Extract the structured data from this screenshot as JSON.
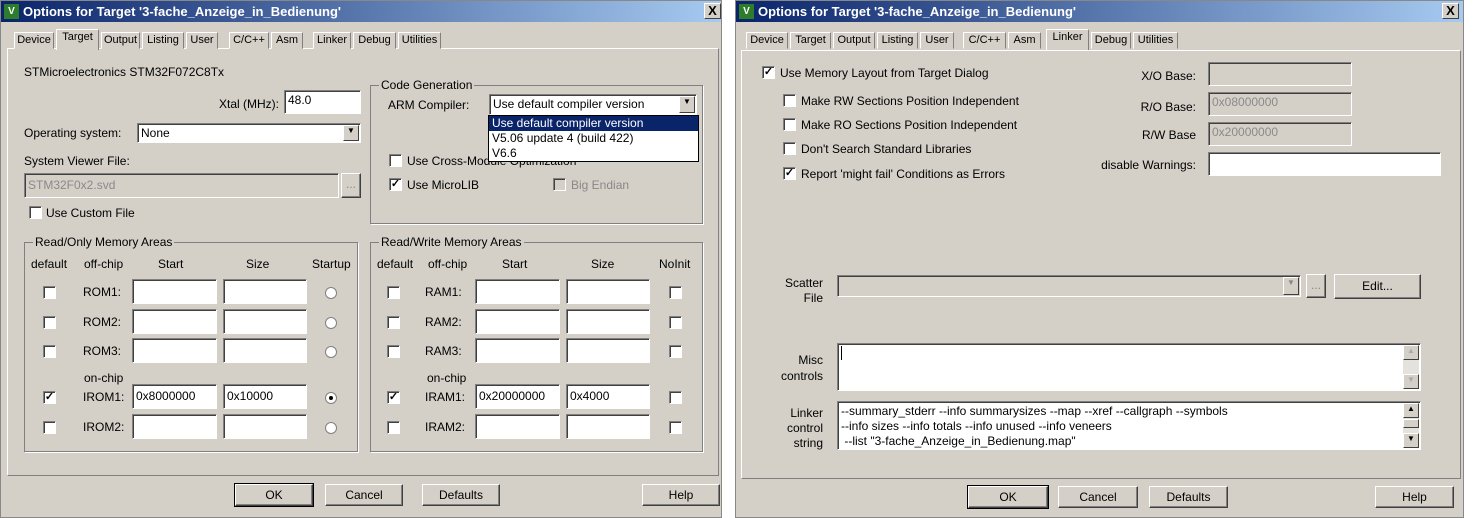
{
  "title": "Options for Target '3-fache_Anzeige_in_Bedienung'",
  "close_glyph": "X",
  "app_icon": "V",
  "tabs": [
    "Device",
    "Target",
    "Output",
    "Listing",
    "User",
    "C/C++",
    "Asm",
    "Linker",
    "Debug",
    "Utilities"
  ],
  "target": {
    "device": "STMicroelectronics STM32F072C8Tx",
    "xtal_label": "Xtal (MHz):",
    "xtal_value": "48.0",
    "os_label": "Operating system:",
    "os_value": "None",
    "svf_label": "System Viewer File:",
    "svf_value": "STM32F0x2.svd",
    "browse": "...",
    "custom_file": "Use Custom File",
    "codegen": {
      "title": "Code Generation",
      "compiler_label": "ARM Compiler:",
      "compiler_value": "Use default compiler version",
      "options": [
        "Use default compiler version",
        "V5.06 update 4 (build 422)",
        "V6.6"
      ],
      "cross_module": "Use Cross-Module Optimization",
      "microlib": "Use MicroLIB",
      "big_endian": "Big Endian"
    },
    "ro": {
      "title": "Read/Only Memory Areas",
      "headers": [
        "default",
        "off-chip",
        "Start",
        "Size",
        "Startup"
      ],
      "onchip": "on-chip",
      "rows": [
        {
          "name": "ROM1:",
          "checked": false,
          "start": "",
          "size": "",
          "radio": false
        },
        {
          "name": "ROM2:",
          "checked": false,
          "start": "",
          "size": "",
          "radio": false
        },
        {
          "name": "ROM3:",
          "checked": false,
          "start": "",
          "size": "",
          "radio": false
        },
        {
          "name": "IROM1:",
          "checked": true,
          "start": "0x8000000",
          "size": "0x10000",
          "radio": true
        },
        {
          "name": "IROM2:",
          "checked": false,
          "start": "",
          "size": "",
          "radio": false
        }
      ]
    },
    "rw": {
      "title": "Read/Write Memory Areas",
      "headers": [
        "default",
        "off-chip",
        "Start",
        "Size",
        "NoInit"
      ],
      "onchip": "on-chip",
      "rows": [
        {
          "name": "RAM1:",
          "checked": false,
          "start": "",
          "size": ""
        },
        {
          "name": "RAM2:",
          "checked": false,
          "start": "",
          "size": ""
        },
        {
          "name": "RAM3:",
          "checked": false,
          "start": "",
          "size": ""
        },
        {
          "name": "IRAM1:",
          "checked": true,
          "start": "0x20000000",
          "size": "0x4000"
        },
        {
          "name": "IRAM2:",
          "checked": false,
          "start": "",
          "size": ""
        }
      ]
    }
  },
  "linker": {
    "use_layout": "Use Memory Layout from Target Dialog",
    "rw_pi": "Make RW Sections Position Independent",
    "ro_pi": "Make RO Sections Position Independent",
    "no_std": "Don't Search Standard Libraries",
    "might_fail": "Report 'might fail' Conditions as Errors",
    "xo_label": "X/O Base:",
    "xo_value": "",
    "ro_label": "R/O Base:",
    "ro_value": "0x08000000",
    "rw_label": "R/W Base",
    "rw_value": "0x20000000",
    "warn_label": "disable Warnings:",
    "warn_value": "",
    "scatter_l1": "Scatter",
    "scatter_l2": "File",
    "edit": "Edit...",
    "browse": "...",
    "misc_l1": "Misc",
    "misc_l2": "controls",
    "lcs_l1": "Linker",
    "lcs_l2": "control",
    "lcs_l3": "string",
    "lcs_lines": [
      "--summary_stderr --info summarysizes --map --xref --callgraph --symbols",
      "--info sizes --info totals --info unused --info veneers",
      " --list \"3-fache_Anzeige_in_Bedienung.map\""
    ]
  },
  "buttons": {
    "ok": "OK",
    "cancel": "Cancel",
    "defaults": "Defaults",
    "help": "Help"
  }
}
